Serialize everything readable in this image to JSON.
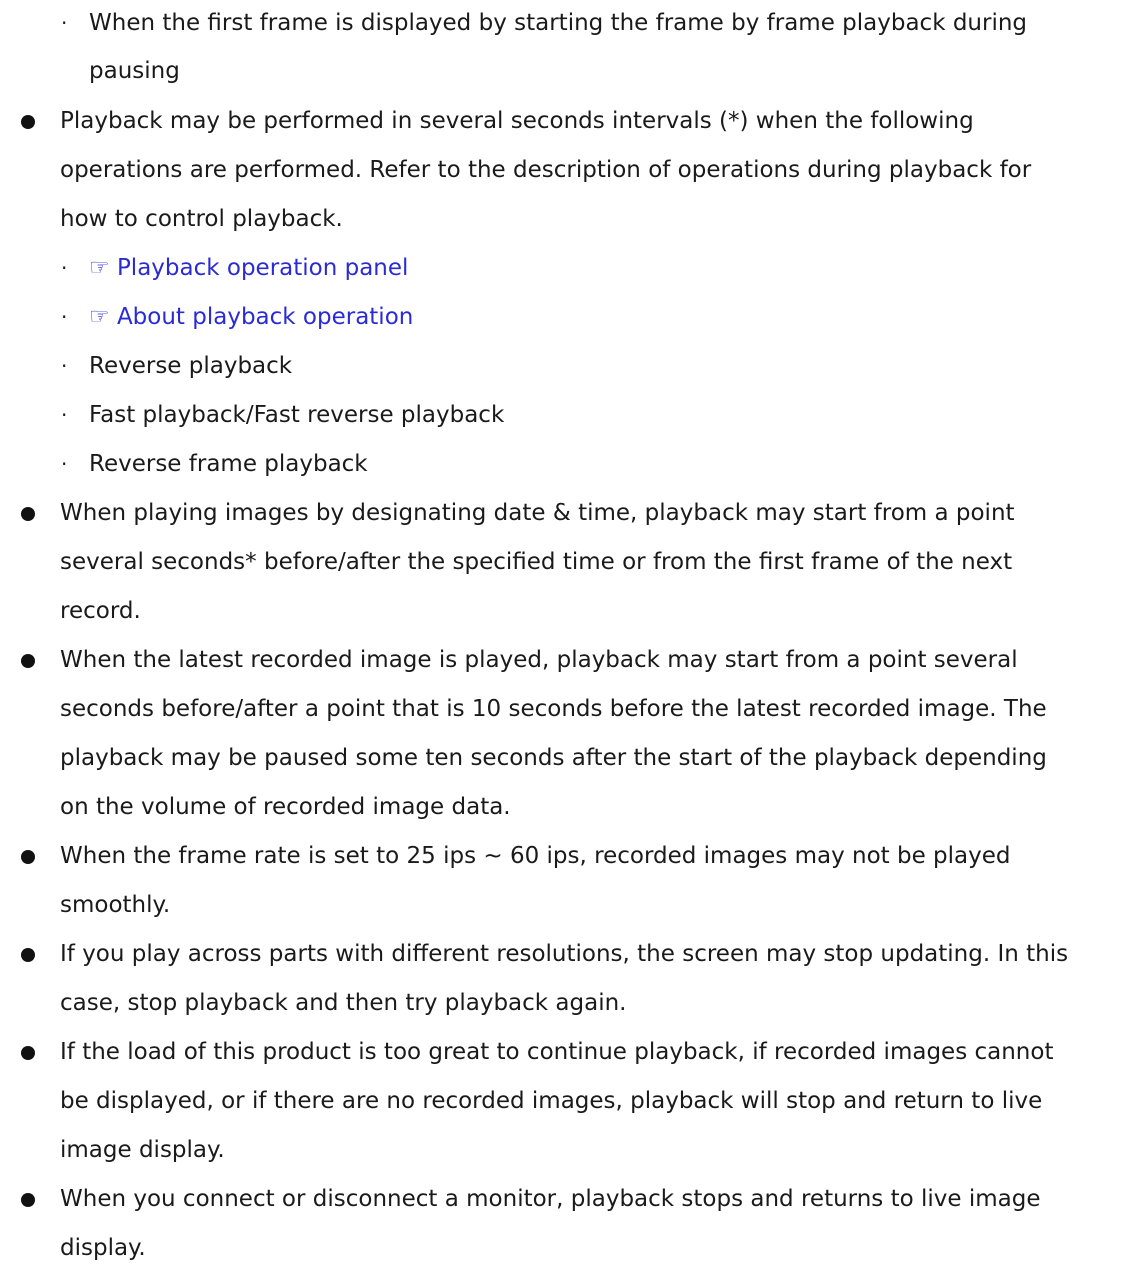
{
  "sub_bullet_top": [
    "When the first frame is displayed by starting the frame by frame playback during",
    "pausing"
  ],
  "bullet1": [
    "Playback may be performed in several seconds intervals (*) when the following",
    "operations are performed. Refer to the description of operations during playback for",
    "how to control playback."
  ],
  "links": {
    "hand_glyph": "☞",
    "panel": "Playback operation panel",
    "about": "About playback operation"
  },
  "sub_items": [
    "Reverse playback",
    "Fast playback/Fast reverse playback",
    "Reverse frame playback"
  ],
  "bullet2": [
    "When playing images by designating date & time, playback may start from a point",
    "several seconds* before/after the specified time or from the first frame of the next",
    "record."
  ],
  "bullet3": [
    "When the latest recorded image is played, playback may start from a point several",
    "seconds before/after a point that is 10 seconds before the latest recorded image. The",
    "playback may be paused some ten seconds after the start of the playback depending",
    "on the volume of recorded image data."
  ],
  "bullet4": [
    "When the frame rate is set to 25 ips ~ 60 ips, recorded images may not be played",
    "smoothly."
  ],
  "bullet5": [
    "If you play across parts with different resolutions, the screen may stop updating. In this",
    "case, stop playback and then try playback again."
  ],
  "bullet6": [
    "If the load of this product is too great to continue playback, if recorded images cannot",
    "be displayed, or if there are no recorded images, playback will stop and return to live",
    "image display."
  ],
  "bullet7": [
    "When you connect or disconnect a monitor, playback stops and returns to live image",
    "display."
  ]
}
